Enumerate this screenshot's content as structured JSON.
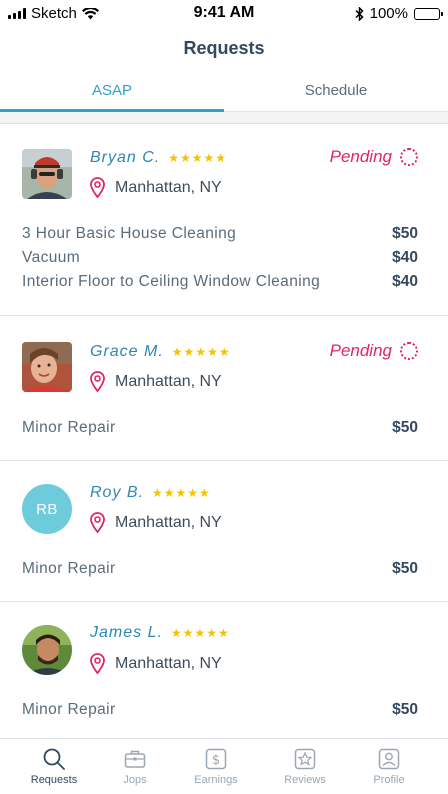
{
  "status_bar": {
    "carrier": "Sketch",
    "time": "9:41 AM",
    "battery": "100%"
  },
  "header": {
    "title": "Requests"
  },
  "tabs": [
    {
      "label": "ASAP",
      "active": true
    },
    {
      "label": "Schedule",
      "active": false
    }
  ],
  "colors": {
    "accent": "#2ea2cf",
    "pending": "#e0265f",
    "star": "#f3c300",
    "location_pin": "#e0265f"
  },
  "requests": [
    {
      "name": "Bryan C.",
      "rating": "★★★★★",
      "location": "Manhattan, NY",
      "status": "Pending",
      "avatar": {
        "type": "photo"
      },
      "services": [
        {
          "label": "3 Hour Basic House Cleaning",
          "price": "$50"
        },
        {
          "label": "Vacuum",
          "price": "$40"
        },
        {
          "label": "Interior Floor to Ceiling Window Cleaning",
          "price": "$40"
        }
      ]
    },
    {
      "name": "Grace M.",
      "rating": "★★★★★",
      "location": "Manhattan, NY",
      "status": "Pending",
      "avatar": {
        "type": "photo"
      },
      "services": [
        {
          "label": "Minor Repair",
          "price": "$50"
        }
      ]
    },
    {
      "name": "Roy B.",
      "rating": "★★★★★",
      "location": "Manhattan, NY",
      "status": "",
      "avatar": {
        "type": "initials",
        "initials": "RB",
        "color": "#6ecbdc"
      },
      "services": [
        {
          "label": "Minor Repair",
          "price": "$50"
        }
      ]
    },
    {
      "name": "James L.",
      "rating": "★★★★★",
      "location": "Manhattan, NY",
      "status": "",
      "avatar": {
        "type": "photo"
      },
      "services": [
        {
          "label": "Minor Repair",
          "price": "$50"
        }
      ]
    }
  ],
  "bottom_nav": [
    {
      "label": "Requests",
      "icon": "search-icon",
      "active": true
    },
    {
      "label": "Jops",
      "icon": "briefcase-icon",
      "active": false
    },
    {
      "label": "Earnings",
      "icon": "dollar-icon",
      "active": false
    },
    {
      "label": "Reviews",
      "icon": "star-icon",
      "active": false
    },
    {
      "label": "Profile",
      "icon": "profile-icon",
      "active": false
    }
  ]
}
